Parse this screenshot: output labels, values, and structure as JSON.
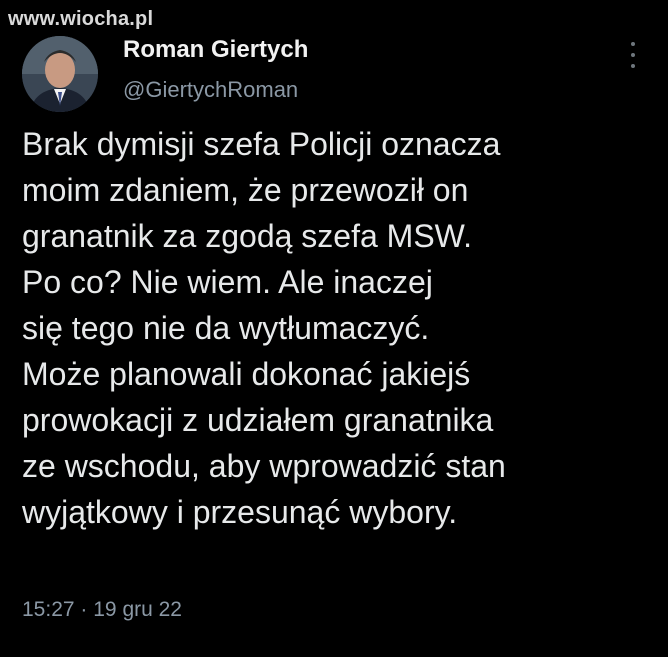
{
  "watermark": "www.wiocha.pl",
  "author": {
    "name": "Roman Giertych",
    "handle": "@GiertychRoman"
  },
  "tweet": {
    "lines": [
      "Brak dymisji szefa Policji oznacza",
      "moim zdaniem, że przewoził on",
      "granatnik za zgodą szefa MSW.",
      "Po co? Nie wiem. Ale inaczej",
      "się tego nie da wytłumaczyć.",
      "Może planowali dokonać jakiejś",
      "prowokacji z udziałem granatnika",
      "ze wschodu, aby wprowadzić stan",
      "wyjątkowy i przesunąć wybory."
    ]
  },
  "meta": {
    "time": "15:27",
    "separator": "·",
    "date": "19 gru 22"
  },
  "icons": {
    "more": "more-vertical-icon",
    "avatar": "avatar"
  },
  "colors": {
    "background": "#000000",
    "text": "#e7e9ea",
    "secondary": "#8b98a5"
  }
}
